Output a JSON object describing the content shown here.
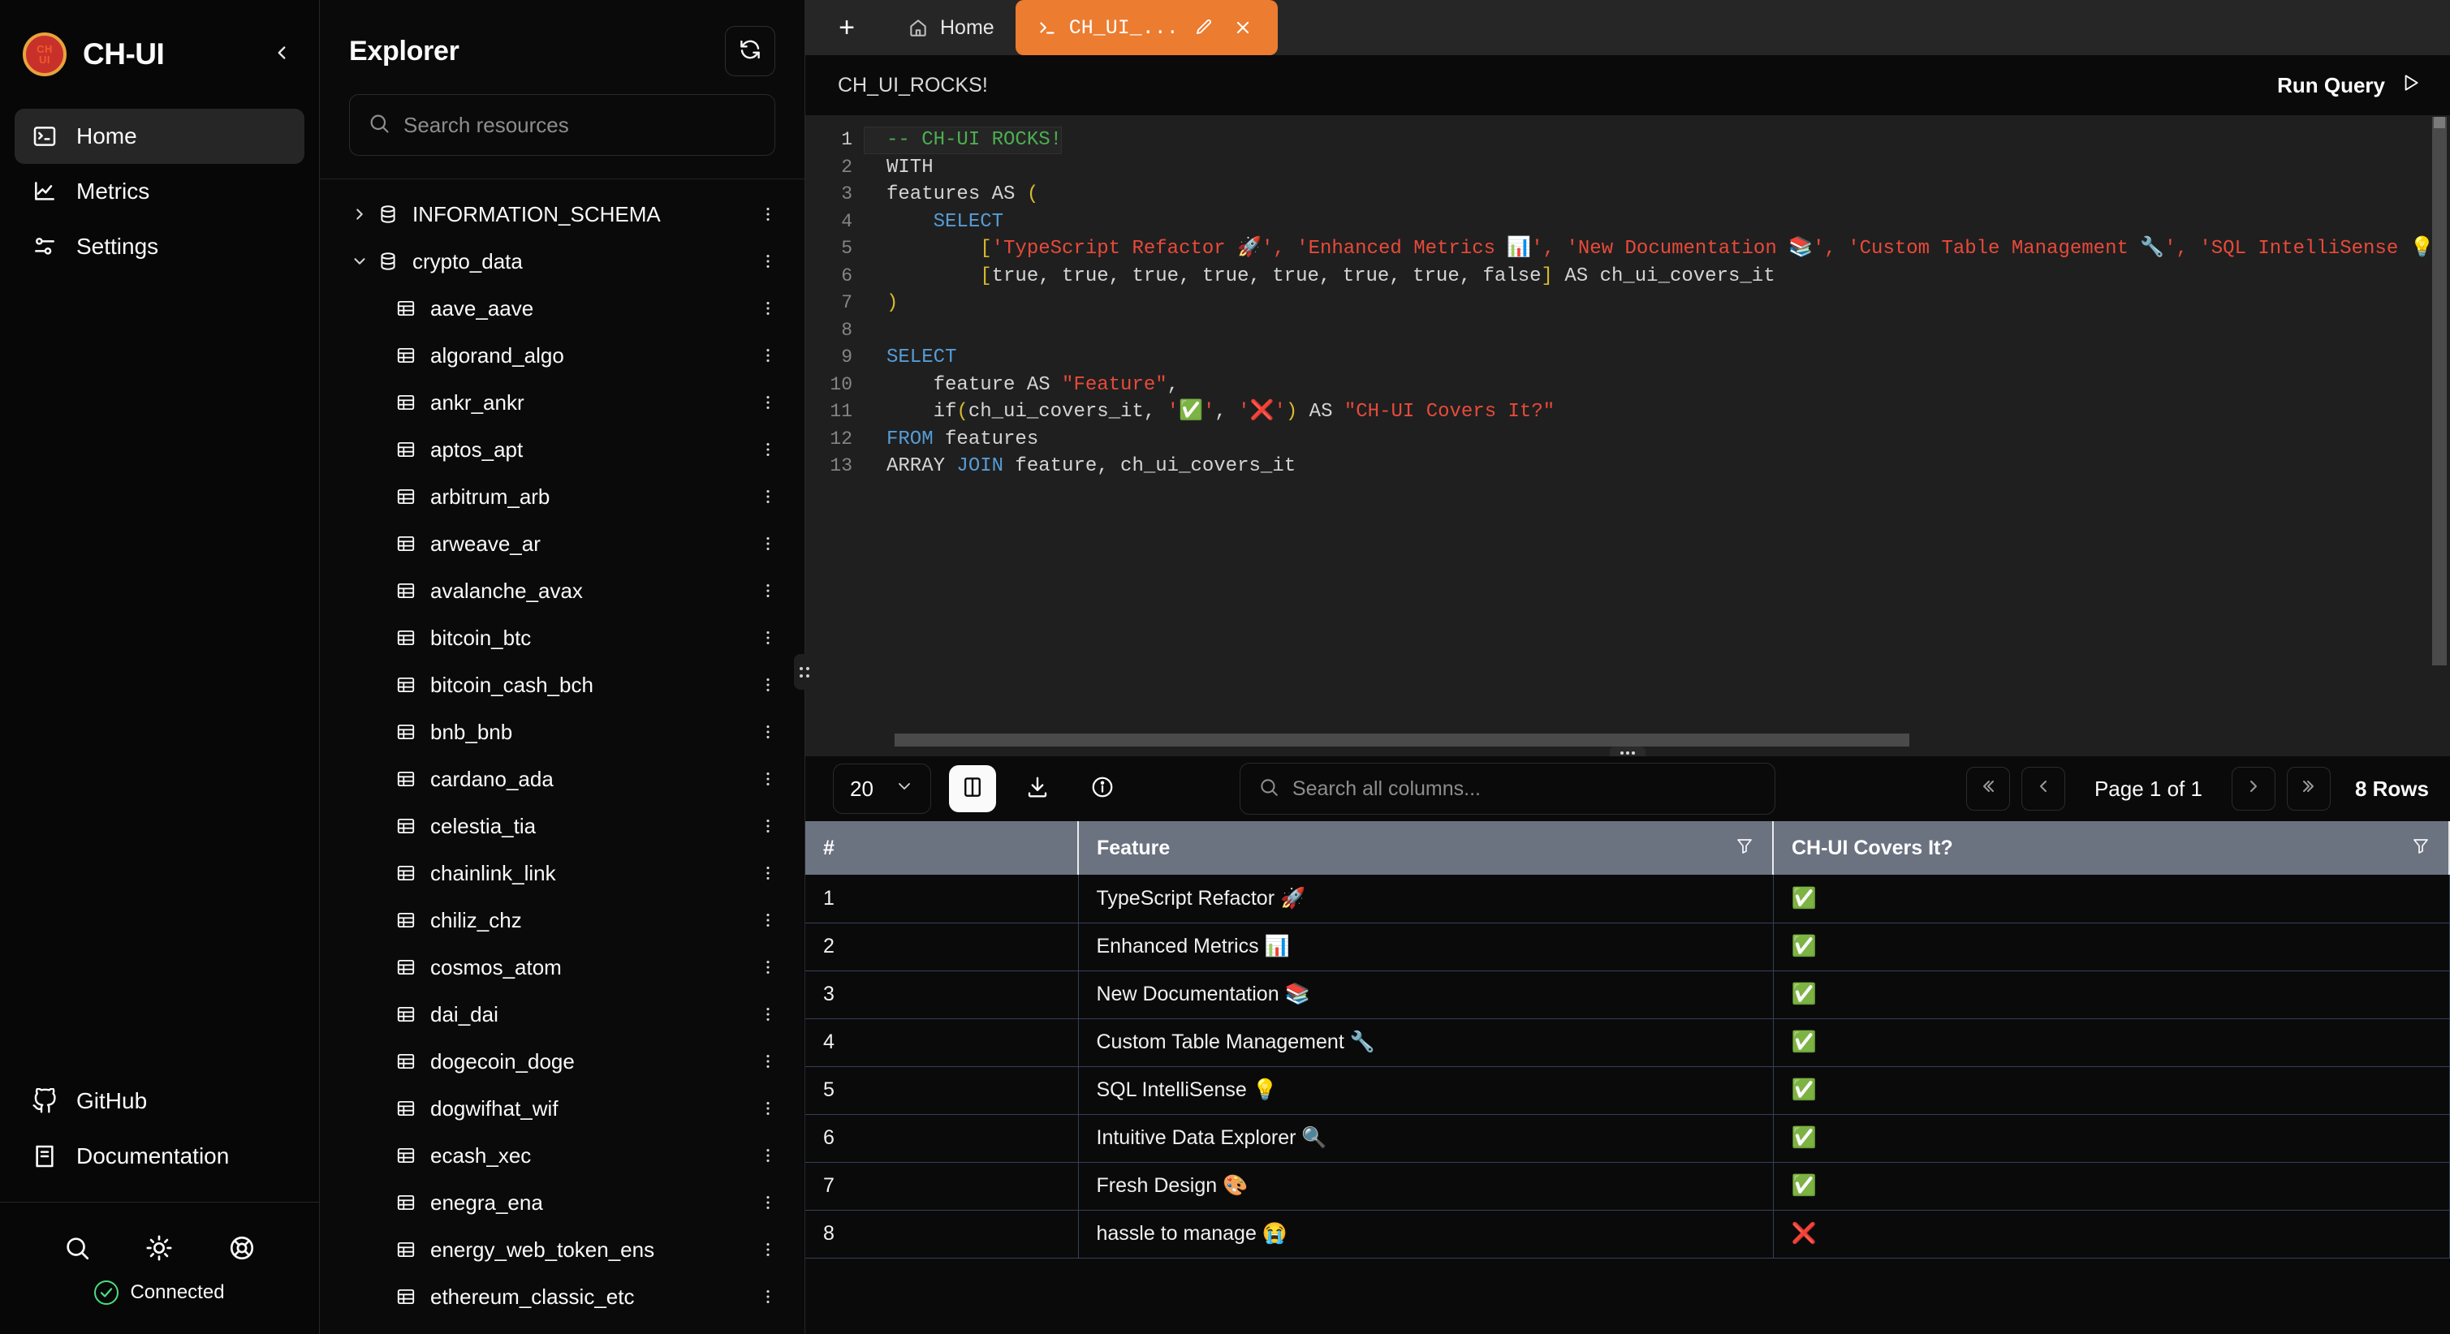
{
  "app": {
    "brand": "CH-UI",
    "logo_line1": "CH",
    "logo_line2": "UI"
  },
  "sidebar": {
    "items": [
      {
        "label": "Home",
        "icon": "terminal-icon",
        "active": true
      },
      {
        "label": "Metrics",
        "icon": "chart-line-icon",
        "active": false
      },
      {
        "label": "Settings",
        "icon": "sliders-icon",
        "active": false
      }
    ],
    "links": [
      {
        "label": "GitHub",
        "icon": "github-icon"
      },
      {
        "label": "Documentation",
        "icon": "book-icon"
      }
    ],
    "tools": [
      {
        "icon": "search-icon"
      },
      {
        "icon": "sun-icon"
      },
      {
        "icon": "lifebuoy-icon"
      }
    ],
    "status": {
      "label": "Connected",
      "icon": "check-circle-icon",
      "color": "#4ade80"
    },
    "collapse_icon": "chevron-left-icon"
  },
  "explorer": {
    "title": "Explorer",
    "refresh_icon": "refresh-icon",
    "search": {
      "placeholder": "Search resources",
      "value": "",
      "icon": "search-icon"
    },
    "databases": [
      {
        "name": "INFORMATION_SCHEMA",
        "expanded": false,
        "icon": "database-icon",
        "menu_icon": "more-vertical-icon"
      },
      {
        "name": "crypto_data",
        "expanded": true,
        "icon": "database-icon",
        "menu_icon": "more-vertical-icon"
      }
    ],
    "tables": [
      "aave_aave",
      "algorand_algo",
      "ankr_ankr",
      "aptos_apt",
      "arbitrum_arb",
      "arweave_ar",
      "avalanche_avax",
      "bitcoin_btc",
      "bitcoin_cash_bch",
      "bnb_bnb",
      "cardano_ada",
      "celestia_tia",
      "chainlink_link",
      "chiliz_chz",
      "cosmos_atom",
      "dai_dai",
      "dogecoin_doge",
      "dogwifhat_wif",
      "ecash_xec",
      "enegra_ena",
      "energy_web_token_ens",
      "ethereum_classic_etc"
    ],
    "table_icon": "table-icon",
    "resize_handle_icon": "grip-vertical-icon"
  },
  "tabbar": {
    "add_label": "+",
    "tabs": [
      {
        "label": "Home",
        "icon": "home-icon",
        "active": false,
        "closable": false
      },
      {
        "label": "CH_UI_...",
        "icon": "terminal-prompt-icon",
        "active": true,
        "closable": true,
        "edit_icon": "pencil-icon",
        "close_icon": "close-icon"
      }
    ]
  },
  "query": {
    "name": "CH_UI_ROCKS!",
    "run_label": "Run Query",
    "run_icon": "play-icon",
    "lines": [
      {
        "n": 1,
        "segments": [
          {
            "t": "-- CH-UI ROCKS!",
            "c": "cmt"
          }
        ],
        "current": true
      },
      {
        "n": 2,
        "segments": [
          {
            "t": "WITH",
            "c": "plain"
          }
        ]
      },
      {
        "n": 3,
        "segments": [
          {
            "t": "features AS ",
            "c": "plain"
          },
          {
            "t": "(",
            "c": "paren"
          }
        ]
      },
      {
        "n": 4,
        "segments": [
          {
            "t": "    ",
            "c": "plain"
          },
          {
            "t": "SELECT",
            "c": "kw"
          }
        ]
      },
      {
        "n": 5,
        "segments": [
          {
            "t": "        ",
            "c": "plain"
          },
          {
            "t": "[",
            "c": "paren"
          },
          {
            "t": "'TypeScript Refactor 🚀', 'Enhanced Metrics 📊', 'New Documentation 📚', 'Custom Table Management 🔧', 'SQL IntelliSense 💡', 'Intuitive Da",
            "c": "str"
          }
        ]
      },
      {
        "n": 6,
        "segments": [
          {
            "t": "        ",
            "c": "plain"
          },
          {
            "t": "[",
            "c": "paren"
          },
          {
            "t": "true, true, true, true, true, true, true, false",
            "c": "plain"
          },
          {
            "t": "]",
            "c": "paren"
          },
          {
            "t": " AS ch_ui_covers_it",
            "c": "plain"
          }
        ]
      },
      {
        "n": 7,
        "segments": [
          {
            "t": ")",
            "c": "paren"
          }
        ]
      },
      {
        "n": 8,
        "segments": [
          {
            "t": "",
            "c": "plain"
          }
        ]
      },
      {
        "n": 9,
        "segments": [
          {
            "t": "SELECT",
            "c": "kw"
          }
        ]
      },
      {
        "n": 10,
        "segments": [
          {
            "t": "    feature AS ",
            "c": "plain"
          },
          {
            "t": "\"Feature\"",
            "c": "str"
          },
          {
            "t": ",",
            "c": "plain"
          }
        ]
      },
      {
        "n": 11,
        "segments": [
          {
            "t": "    if",
            "c": "plain"
          },
          {
            "t": "(",
            "c": "paren"
          },
          {
            "t": "ch_ui_covers_it, ",
            "c": "plain"
          },
          {
            "t": "'✅'",
            "c": "str"
          },
          {
            "t": ", ",
            "c": "plain"
          },
          {
            "t": "'❌'",
            "c": "str"
          },
          {
            "t": ")",
            "c": "paren"
          },
          {
            "t": " AS ",
            "c": "plain"
          },
          {
            "t": "\"CH-UI Covers It?\"",
            "c": "str"
          }
        ]
      },
      {
        "n": 12,
        "segments": [
          {
            "t": "FROM",
            "c": "kw"
          },
          {
            "t": " features",
            "c": "plain"
          }
        ]
      },
      {
        "n": 13,
        "segments": [
          {
            "t": "ARRAY ",
            "c": "plain"
          },
          {
            "t": "JOIN",
            "c": "kw"
          },
          {
            "t": " feature, ch_ui_covers_it",
            "c": "plain"
          }
        ]
      }
    ]
  },
  "results_toolbar": {
    "page_size": "20",
    "page_size_chevron": "chevron-down-icon",
    "buttons": [
      {
        "icon": "columns-icon",
        "selected": true
      },
      {
        "icon": "download-icon",
        "selected": false
      },
      {
        "icon": "info-icon",
        "selected": false
      }
    ],
    "search": {
      "placeholder": "Search all columns...",
      "value": "",
      "icon": "search-icon"
    },
    "pagination": {
      "first_icon": "chevrons-left-icon",
      "prev_icon": "chevron-left-icon",
      "label": "Page 1 of 1",
      "next_icon": "chevron-right-icon",
      "last_icon": "chevrons-right-icon",
      "rows_label": "8 Rows"
    }
  },
  "results_table": {
    "columns": [
      {
        "label": "#",
        "filter_icon": null
      },
      {
        "label": "Feature",
        "filter_icon": "filter-icon"
      },
      {
        "label": "CH-UI Covers It?",
        "filter_icon": "filter-icon"
      }
    ],
    "rows": [
      {
        "num": "1",
        "feature": "TypeScript Refactor 🚀",
        "covered": "✅"
      },
      {
        "num": "2",
        "feature": "Enhanced Metrics 📊",
        "covered": "✅"
      },
      {
        "num": "3",
        "feature": "New Documentation 📚",
        "covered": "✅"
      },
      {
        "num": "4",
        "feature": "Custom Table Management 🔧",
        "covered": "✅"
      },
      {
        "num": "5",
        "feature": "SQL IntelliSense 💡",
        "covered": "✅"
      },
      {
        "num": "6",
        "feature": "Intuitive Data Explorer 🔍",
        "covered": "✅"
      },
      {
        "num": "7",
        "feature": "Fresh Design 🎨",
        "covered": "✅"
      },
      {
        "num": "8",
        "feature": "hassle to manage 😭",
        "covered": "❌"
      }
    ]
  },
  "colors": {
    "accent": "#ec7c30",
    "header_bg": "#6b7280",
    "connected": "#4ade80",
    "logo_ring": "#e8a33d",
    "logo_fill": "#c8312a"
  }
}
